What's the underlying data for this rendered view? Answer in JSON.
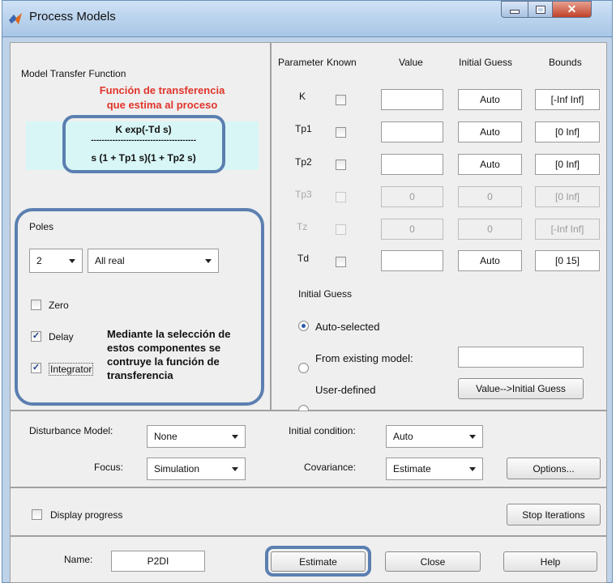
{
  "window": {
    "title": "Process Models"
  },
  "tf": {
    "heading": "Model Transfer Function",
    "annotation_line1": "Función de transferencia",
    "annotation_line2": "que estima al proceso",
    "numerator": "K exp(-Td s)",
    "divider": "---------------------------------------",
    "denominator": "s (1 + Tp1 s)(1 + Tp2 s)"
  },
  "poles": {
    "label": "Poles",
    "count": "2",
    "type": "All real",
    "zero_label": "Zero",
    "delay_label": "Delay",
    "integrator_label": "Integrator",
    "zero_checked": false,
    "delay_checked": true,
    "integrator_checked": true,
    "annotation": [
      "Mediante la selección de",
      "estos componentes se",
      "contruye la función de",
      "transferencia"
    ]
  },
  "params": {
    "headers": {
      "parameter": "Parameter",
      "known": "Known",
      "value": "Value",
      "initial_guess": "Initial Guess",
      "bounds": "Bounds"
    },
    "rows": [
      {
        "name": "K",
        "value": "",
        "initial": "Auto",
        "bounds": "[-Inf Inf]",
        "enabled": true
      },
      {
        "name": "Tp1",
        "value": "",
        "initial": "Auto",
        "bounds": "[0 Inf]",
        "enabled": true
      },
      {
        "name": "Tp2",
        "value": "",
        "initial": "Auto",
        "bounds": "[0 Inf]",
        "enabled": true
      },
      {
        "name": "Tp3",
        "value": "0",
        "initial": "0",
        "bounds": "[0 Inf]",
        "enabled": false
      },
      {
        "name": "Tz",
        "value": "0",
        "initial": "0",
        "bounds": "[-Inf Inf]",
        "enabled": false
      },
      {
        "name": "Td",
        "value": "",
        "initial": "Auto",
        "bounds": "[0 15]",
        "enabled": true
      }
    ]
  },
  "initial_guess": {
    "title": "Initial Guess",
    "auto": "Auto-selected",
    "existing": "From existing model:",
    "user": "User-defined",
    "existing_value": "",
    "value_button": "Value-->Initial Guess",
    "selected": "auto"
  },
  "options": {
    "disturbance_label": "Disturbance Model:",
    "disturbance_value": "None",
    "focus_label": "Focus:",
    "focus_value": "Simulation",
    "initial_condition_label": "Initial condition:",
    "initial_condition_value": "Auto",
    "covariance_label": "Covariance:",
    "covariance_value": "Estimate",
    "options_button": "Options..."
  },
  "progress": {
    "display_label": "Display progress",
    "stop_button": "Stop Iterations"
  },
  "footer": {
    "name_label": "Name:",
    "name_value": "P2DI",
    "estimate": "Estimate",
    "close": "Close",
    "help": "Help"
  },
  "colors": {
    "annotation_red": "#e0352b",
    "annotation_border": "#5b7fb0",
    "tf_background": "#d8f6f6"
  }
}
